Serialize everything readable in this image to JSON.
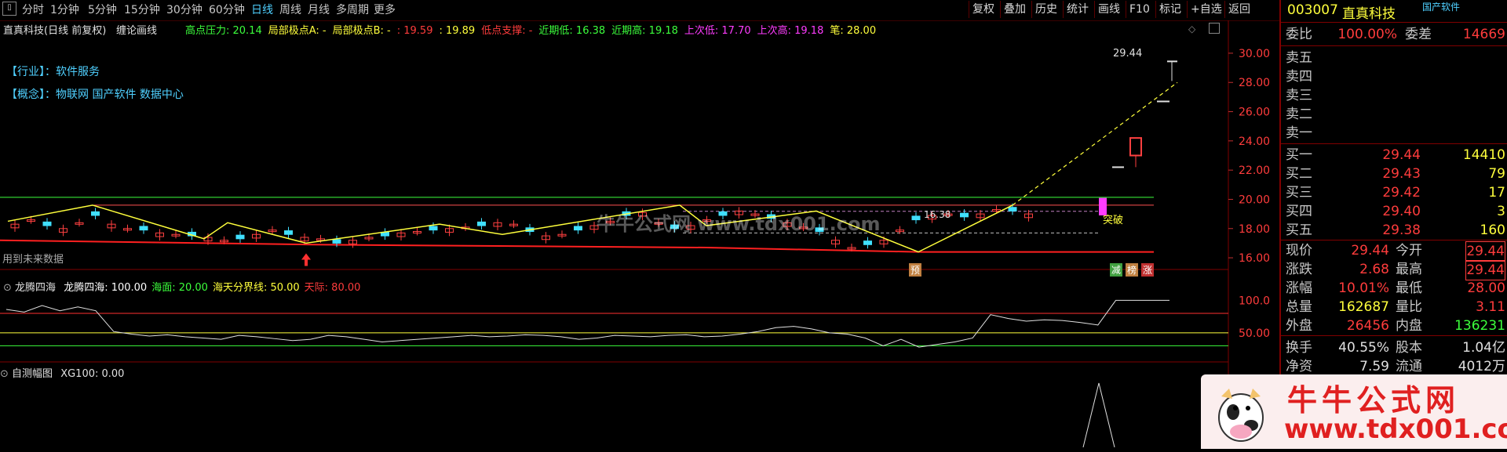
{
  "toolbar": {
    "periods": [
      "分时",
      "1分钟",
      "5分钟",
      "15分钟",
      "30分钟",
      "60分钟",
      "日线",
      "周线",
      "月线",
      "多周期",
      "更多"
    ],
    "active_period": "日线",
    "buttons": [
      "复权",
      "叠加",
      "历史",
      "统计",
      "画线",
      "F10",
      "标记",
      "+自选",
      "返回"
    ]
  },
  "main_chart": {
    "title": "直真科技(日线 前复权)",
    "indicator_name": "缠论画线",
    "legend": [
      {
        "label": "高点压力: 20.14",
        "color": "#3cff3c"
      },
      {
        "label": "局部极点A: -",
        "color": "#ffff3c"
      },
      {
        "label": "局部极点B: -",
        "color": "#ffff3c"
      },
      {
        "label": ": 19.59",
        "color": "#ff3c3c"
      },
      {
        "label": ": 19.89",
        "color": "#ffff3c"
      },
      {
        "label": "低点支撑: -",
        "color": "#ff3c3c"
      },
      {
        "label": "近期低: 16.38",
        "color": "#3cff3c"
      },
      {
        "label": "近期高: 19.18",
        "color": "#3cff3c"
      },
      {
        "label": "上次低: 17.70",
        "color": "#ff3cff"
      },
      {
        "label": "上次高: 19.18",
        "color": "#ff3cff"
      },
      {
        "label": "笔: 28.00",
        "color": "#ffff3c"
      }
    ],
    "industry_label": "【行业】：",
    "industry_value": "软件服务",
    "concept_label": "【概念】：",
    "concept_value": "物联网 国产软件 数据中心",
    "future_note": "用到未来数据",
    "price_axis": [
      "30.00",
      "28.00",
      "26.00",
      "24.00",
      "22.00",
      "20.00",
      "18.00",
      "16.00"
    ],
    "annotations": {
      "last_high": "29.44",
      "low_mark": "16.38",
      "breakout": "突破",
      "yu": "预",
      "jian": "减",
      "bang": "榜",
      "zhang": "涨"
    }
  },
  "sub1": {
    "name": "龙腾四海",
    "values": [
      {
        "label": "龙腾四海: 100.00",
        "color": "#ffffff"
      },
      {
        "label": "海面: 20.00",
        "color": "#3cff3c"
      },
      {
        "label": "海天分界线: 50.00",
        "color": "#ffff3c"
      },
      {
        "label": "天际: 80.00",
        "color": "#ff3c3c"
      }
    ],
    "axis": [
      "100.0",
      "50.00"
    ]
  },
  "sub2": {
    "name": "自测幅图",
    "value": "XG100: 0.00"
  },
  "quote": {
    "code": "003007",
    "name": "直真科技",
    "tag": "国产软件",
    "weibi_label": "委比",
    "weibi": "100.00%",
    "weicha_label": "委差",
    "weicha": "14669",
    "sells": [
      {
        "label": "卖五"
      },
      {
        "label": "卖四"
      },
      {
        "label": "卖三"
      },
      {
        "label": "卖二"
      },
      {
        "label": "卖一"
      }
    ],
    "buys": [
      {
        "label": "买一",
        "price": "29.44",
        "vol": "14410"
      },
      {
        "label": "买二",
        "price": "29.43",
        "vol": "79"
      },
      {
        "label": "买三",
        "price": "29.42",
        "vol": "17"
      },
      {
        "label": "买四",
        "price": "29.40",
        "vol": "3"
      },
      {
        "label": "买五",
        "price": "29.38",
        "vol": "160"
      }
    ],
    "stats": [
      {
        "l1": "现价",
        "v1": "29.44",
        "c1": "up",
        "l2": "今开",
        "v2": "29.44",
        "c2": "up"
      },
      {
        "l1": "涨跌",
        "v1": "2.68",
        "c1": "up",
        "l2": "最高",
        "v2": "29.44",
        "c2": "up"
      },
      {
        "l1": "涨幅",
        "v1": "10.01%",
        "c1": "up",
        "l2": "最低",
        "v2": "28.00",
        "c2": "up"
      },
      {
        "l1": "总量",
        "v1": "162687",
        "c1": "yl",
        "l2": "量比",
        "v2": "3.11",
        "c2": "up"
      },
      {
        "l1": "外盘",
        "v1": "26456",
        "c1": "up",
        "l2": "内盘",
        "v2": "136231",
        "c2": "dn"
      }
    ],
    "stats2": [
      {
        "l1": "换手",
        "v1": "40.55%",
        "l2": "股本",
        "v2": "1.04亿"
      },
      {
        "l1": "净资",
        "v1": "7.59",
        "l2": "流通",
        "v2": "4012万"
      }
    ]
  },
  "watermark": {
    "center": "牛牛公式网 www.tdx001.com",
    "logo_top": "牛牛公式网",
    "logo_bottom": "www.tdx001.com"
  }
}
